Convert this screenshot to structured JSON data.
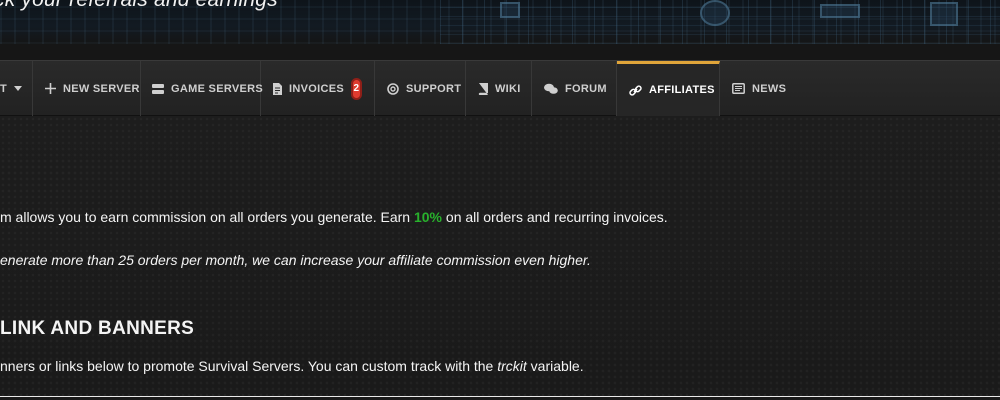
{
  "hero": {
    "subtitle": "ck your referrals and earnings"
  },
  "nav": {
    "items": [
      {
        "label": "T",
        "icon": "chevron-down-icon"
      },
      {
        "label": "NEW SERVER",
        "icon": "plus-icon"
      },
      {
        "label": "GAME SERVERS",
        "icon": "server-icon"
      },
      {
        "label": "INVOICES",
        "icon": "invoice-icon",
        "badge": "2"
      },
      {
        "label": "SUPPORT",
        "icon": "lifebuoy-icon"
      },
      {
        "label": "WIKI",
        "icon": "book-icon"
      },
      {
        "label": "FORUM",
        "icon": "comments-icon"
      },
      {
        "label": "AFFILIATES",
        "icon": "link-icon",
        "active": true
      },
      {
        "label": "NEWS",
        "icon": "newspaper-icon"
      }
    ]
  },
  "content": {
    "intro_before": "m allows you to earn commission on all orders you generate. Earn ",
    "intro_highlight": "10%",
    "intro_after": " on all orders and recurring invoices.",
    "note": "enerate more than 25 orders per month, we can increase your affiliate commission even higher.",
    "section_heading": "LINK AND BANNERS",
    "section_text_before": "nners or links below to promote Survival Servers. You can custom track with the ",
    "section_text_em": "trckit",
    "section_text_after": " variable."
  },
  "colors": {
    "accent": "#e0a53a",
    "highlight": "#28b12c",
    "badge": "#e03b2f"
  }
}
